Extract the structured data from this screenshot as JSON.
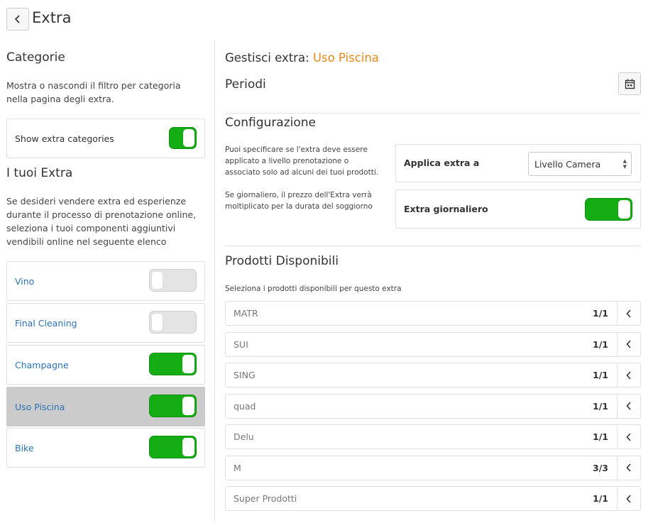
{
  "header": {
    "title": "Extra",
    "back_icon": "chevron-left-icon"
  },
  "categories": {
    "title": "Categorie",
    "description": "Mostra o nascondi il filtro per categoria nella pagina degli extra.",
    "show_label": "Show extra categories",
    "show_enabled": true
  },
  "extras_section": {
    "title": "I tuoi Extra",
    "description": "Se desideri vendere extra ed esperienze durante il processo di prenotazione online, seleziona i tuoi componenti aggiuntivi vendibili online nel seguente elenco",
    "items": [
      {
        "label": "Vino",
        "enabled": false,
        "selected": false
      },
      {
        "label": "Final Cleaning",
        "enabled": false,
        "selected": false
      },
      {
        "label": "Champagne",
        "enabled": true,
        "selected": false
      },
      {
        "label": "Uso Piscina",
        "enabled": true,
        "selected": true
      },
      {
        "label": "Bike",
        "enabled": true,
        "selected": false
      }
    ]
  },
  "manage": {
    "prefix": "Gestisci extra:",
    "extra_name": "Uso Piscina",
    "accent_color": "#e8891a"
  },
  "periods": {
    "title": "Periodi",
    "calendar_icon": "calendar-icon"
  },
  "configuration": {
    "title": "Configurazione",
    "apply_desc": "Puoi specificare se l'extra deve essere applicato a livello prenotazione o associato solo ad alcuni dei tuoi prodotti.",
    "apply_label": "Applica extra a",
    "apply_value": "Livello Camera",
    "daily_desc": "Se giornaliero, il prezzo dell'Extra verrà moltiplicato per la durata del soggiorno",
    "daily_label": "Extra giornaliero",
    "daily_enabled": true
  },
  "products": {
    "title": "Prodotti Disponibili",
    "description": "Seleziona i prodotti disponibili per questo extra",
    "items": [
      {
        "name": "MATR",
        "count": "1/1"
      },
      {
        "name": "SUI",
        "count": "1/1"
      },
      {
        "name": "SING",
        "count": "1/1"
      },
      {
        "name": "quad",
        "count": "1/1"
      },
      {
        "name": "Delu",
        "count": "1/1"
      },
      {
        "name": "M",
        "count": "3/3"
      },
      {
        "name": "Super Prodotti",
        "count": "1/1"
      }
    ]
  },
  "colors": {
    "toggle_on": "#14ad14",
    "link": "#2a72b5",
    "selected_bg": "#cbcbcb"
  }
}
